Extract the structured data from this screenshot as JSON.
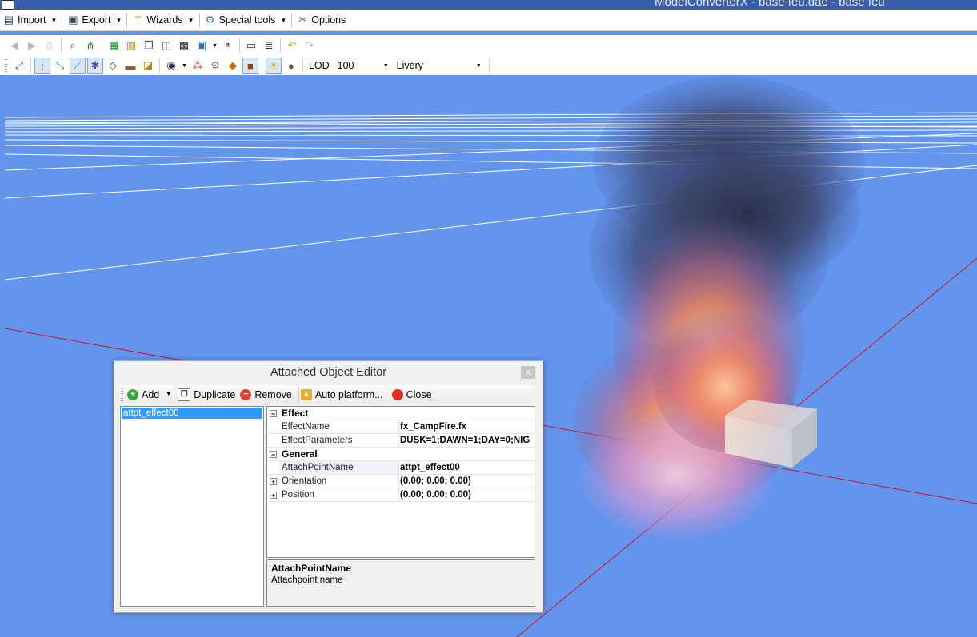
{
  "window": {
    "title": "ModelConverterX - base feu.dae - base feu"
  },
  "menu": [
    {
      "label": "Import",
      "icon": "import-icon",
      "dropdown": true
    },
    {
      "label": "Export",
      "icon": "export-icon",
      "dropdown": true
    },
    {
      "label": "Wizards",
      "icon": "wand-icon",
      "dropdown": true
    },
    {
      "label": "Special tools",
      "icon": "gear-icon",
      "dropdown": true
    },
    {
      "label": "Options",
      "icon": "tools-icon",
      "dropdown": false
    }
  ],
  "toolbar2": {
    "lod_label": "LOD",
    "lod_value": "100",
    "livery_value": "Livery"
  },
  "dialog": {
    "title": "Attached Object Editor",
    "close_glyph": "x",
    "toolbar": {
      "add": "Add",
      "duplicate": "Duplicate",
      "remove": "Remove",
      "auto_platform": "Auto platform...",
      "close": "Close"
    },
    "objects": [
      "attpt_effect00"
    ],
    "categories": {
      "effect": "Effect",
      "general": "General"
    },
    "properties": {
      "effect_name": {
        "name": "EffectName",
        "value": "fx_CampFire.fx"
      },
      "effect_params": {
        "name": "EffectParameters",
        "value": "DUSK=1;DAWN=1;DAY=0;NIG"
      },
      "attach_point": {
        "name": "AttachPointName",
        "value": "attpt_effect00"
      },
      "orientation": {
        "name": "Orientation",
        "value": "(0.00; 0.00; 0.00)"
      },
      "position": {
        "name": "Position",
        "value": "(0.00; 0.00; 0.00)"
      }
    },
    "help": {
      "title": "AttachPointName",
      "description": "Attachpoint name"
    }
  },
  "colors": {
    "viewport_bg": "#6495ed",
    "grid": "#ffffff",
    "axis": "#d0142a",
    "selection": "#3399ff"
  }
}
